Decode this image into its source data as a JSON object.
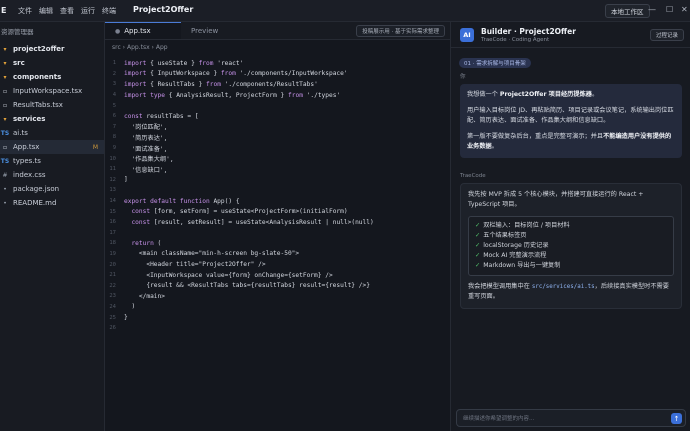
{
  "titlebar": {
    "logo": "E",
    "menus": [
      "文件",
      "编辑",
      "查看",
      "运行",
      "终端"
    ],
    "project_title": "Project2Offer",
    "workspace_label": "本地工作区",
    "controls": [
      "—",
      "☐",
      "✕"
    ]
  },
  "sidebar": {
    "title": "资源管理器",
    "items": [
      {
        "label": "project2offer",
        "type": "folder",
        "icon": "folder-open-icon"
      },
      {
        "label": "src",
        "type": "folder",
        "icon": "folder-open-icon"
      },
      {
        "label": "components",
        "type": "folder",
        "icon": "folder-open-icon"
      },
      {
        "label": "InputWorkspace.tsx",
        "type": "file",
        "icon": "file-icon"
      },
      {
        "label": "ResultTabs.tsx",
        "type": "file",
        "icon": "file-icon"
      },
      {
        "label": "services",
        "type": "folder",
        "icon": "folder-open-icon"
      },
      {
        "label": "ai.ts",
        "type": "ts",
        "icon": "TS"
      },
      {
        "label": "App.tsx",
        "type": "file",
        "icon": "file-icon",
        "badge": "M",
        "active": true
      },
      {
        "label": "types.ts",
        "type": "ts",
        "icon": "TS"
      },
      {
        "label": "index.css",
        "type": "css",
        "icon": "#"
      },
      {
        "label": "package.json",
        "type": "json",
        "icon": "•"
      },
      {
        "label": "README.md",
        "type": "md",
        "icon": "•"
      }
    ]
  },
  "editor": {
    "tabs": [
      {
        "label": "App.tsx",
        "active": true
      },
      {
        "label": "Preview",
        "active": false
      }
    ],
    "note": "投稿展示用 · 基于实际需求整理",
    "breadcrumb": "src › App.tsx › App",
    "lines": [
      "import { useState } from 'react'",
      "import { InputWorkspace } from './components/InputWorkspace'",
      "import { ResultTabs } from './components/ResultTabs'",
      "import type { AnalysisResult, ProjectForm } from './types'",
      "",
      "const resultTabs = [",
      "  '岗位匹配',",
      "  '简历表达',",
      "  '面试准备',",
      "  '作品集大纲',",
      "  '信息缺口',",
      "]",
      "",
      "export default function App() {",
      "  const [form, setForm] = useState<ProjectForm>(initialForm)",
      "  const [result, setResult] = useState<AnalysisResult | null>(null)",
      "",
      "  return (",
      "    <main className=\"min-h-screen bg-slate-50\">",
      "      <Header title=\"Project2Offer\" />",
      "      <InputWorkspace value={form} onChange={setForm} />",
      "      {result && <ResultTabs tabs={resultTabs} result={result} />}",
      "    </main>",
      "  )",
      "}",
      ""
    ]
  },
  "panel": {
    "avatar": "AI",
    "title": "Builder · Project2Offer",
    "subtitle": "TraeCode · Coding Agent",
    "history_label": "过程记录",
    "task_chip": "01 · 需求拆解与项目骨架",
    "user_sender": "你",
    "user_p1_a": "我想做一个 ",
    "user_p1_b": "Project2Offer 项目经历提炼器",
    "user_p1_c": "。",
    "user_p2": "用户输入目标岗位 JD、再粘贴简历、项目记录或会议笔记，系统输出岗位匹配、简历表达、面试准备、作品集大纲和信息缺口。",
    "user_p3_a": "第一版不要做复杂后台，重点是完整可演示；并且",
    "user_p3_b": "不能编造用户没有提供的业务数据",
    "user_p3_c": "。",
    "ai_sender": "TraeCode",
    "ai_intro": "我先按 MVP 拆成 5 个核心模块，并搭建可直接运行的 React + TypeScript 项目。",
    "checklist": [
      "双栏输入：目标岗位 / 项目材料",
      "五个结果标签页",
      "localStorage 历史记录",
      "Mock AI 完整演示流程",
      "Markdown 导出与一键复制"
    ],
    "ai_outro_a": "我会把模型调用集中在 ",
    "ai_outro_code": "src/services/ai.ts",
    "ai_outro_b": "，后续接真实模型时不需要重写页面。",
    "input_placeholder": "继续描述你希望调整的内容…",
    "send_icon": "↑"
  }
}
